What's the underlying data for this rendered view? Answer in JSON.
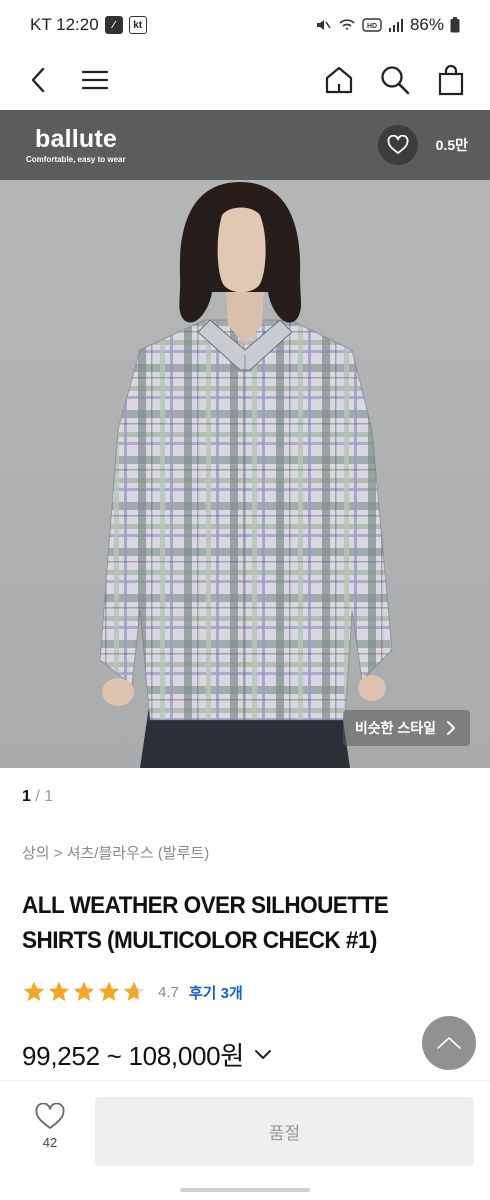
{
  "status_bar": {
    "carrier_time": "KT 12:20",
    "badge1": "⁄",
    "badge2": "kt",
    "battery": "86%"
  },
  "nav": {
    "back_icon": "chevron-left-icon",
    "menu_icon": "hamburger-menu-icon",
    "home_icon": "home-icon",
    "search_icon": "search-icon",
    "cart_icon": "shopping-bag-icon"
  },
  "brand": {
    "name": "ballute",
    "tagline": "Comfortable, easy to wear",
    "like_count": "0.5만"
  },
  "image": {
    "similar_style_label": "비슷한 스타일"
  },
  "pager": {
    "current": "1",
    "separator": "/",
    "total": "1"
  },
  "breadcrumb": "상의 > 셔츠/블라우스 (발루트)",
  "product": {
    "title": "ALL WEATHER OVER SILHOUETTE SHIRTS (MULTICOLOR CHECK #1)",
    "rating": 4.7,
    "rating_label": "4.7",
    "review_label": "후기 3개",
    "price": "99,252 ~ 108,000원"
  },
  "bottom_bar": {
    "wish_count": "42",
    "soldout_label": "품절"
  },
  "colors": {
    "brand_bar": "#5c5c5e",
    "star": "#f5a623",
    "review_link": "#1a5bd8"
  }
}
